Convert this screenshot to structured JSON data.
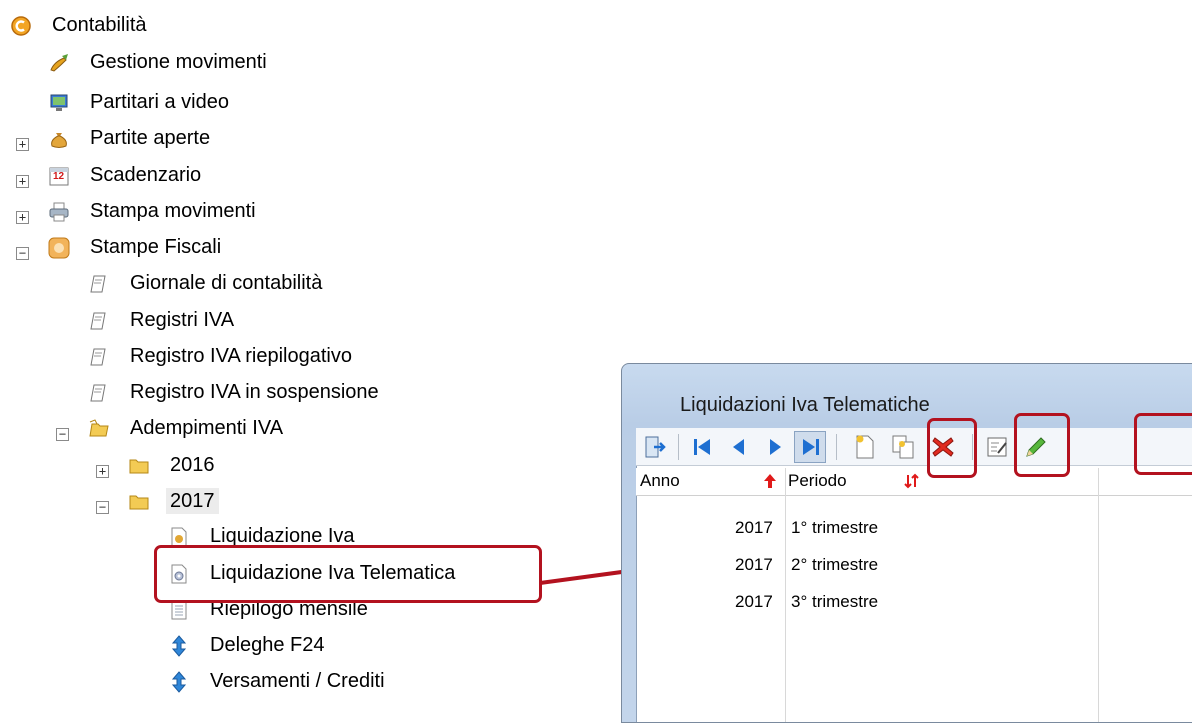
{
  "tree": {
    "root": "Contabilità",
    "items": [
      {
        "label": "Gestione movimenti"
      },
      {
        "label": "Partitari a video"
      },
      {
        "label": "Partite aperte"
      },
      {
        "label": "Scadenzario"
      },
      {
        "label": "Stampa movimenti"
      },
      {
        "label": "Stampe Fiscali"
      },
      {
        "label": "Giornale di contabilità"
      },
      {
        "label": "Registri IVA"
      },
      {
        "label": "Registro IVA riepilogativo"
      },
      {
        "label": "Registro IVA in sospensione"
      },
      {
        "label": "Adempimenti IVA"
      },
      {
        "label": "2016"
      },
      {
        "label": "2017"
      },
      {
        "label": "Liquidazione Iva"
      },
      {
        "label": "Liquidazione Iva Telematica"
      },
      {
        "label": "Riepilogo mensile"
      },
      {
        "label": "Deleghe F24"
      },
      {
        "label": "Versamenti / Crediti"
      }
    ],
    "calendar_number": "12"
  },
  "dialog": {
    "title": "Liquidazioni Iva Telematiche",
    "columns": [
      "Anno",
      "Periodo"
    ],
    "rows": [
      {
        "anno": "2017",
        "periodo": "1° trimestre"
      },
      {
        "anno": "2017",
        "periodo": "2° trimestre"
      },
      {
        "anno": "2017",
        "periodo": "3° trimestre"
      }
    ]
  },
  "colors": {
    "highlight": "#b3121f",
    "window_frame": "#c3d5eb",
    "nav_blue": "#1e6fd1"
  }
}
